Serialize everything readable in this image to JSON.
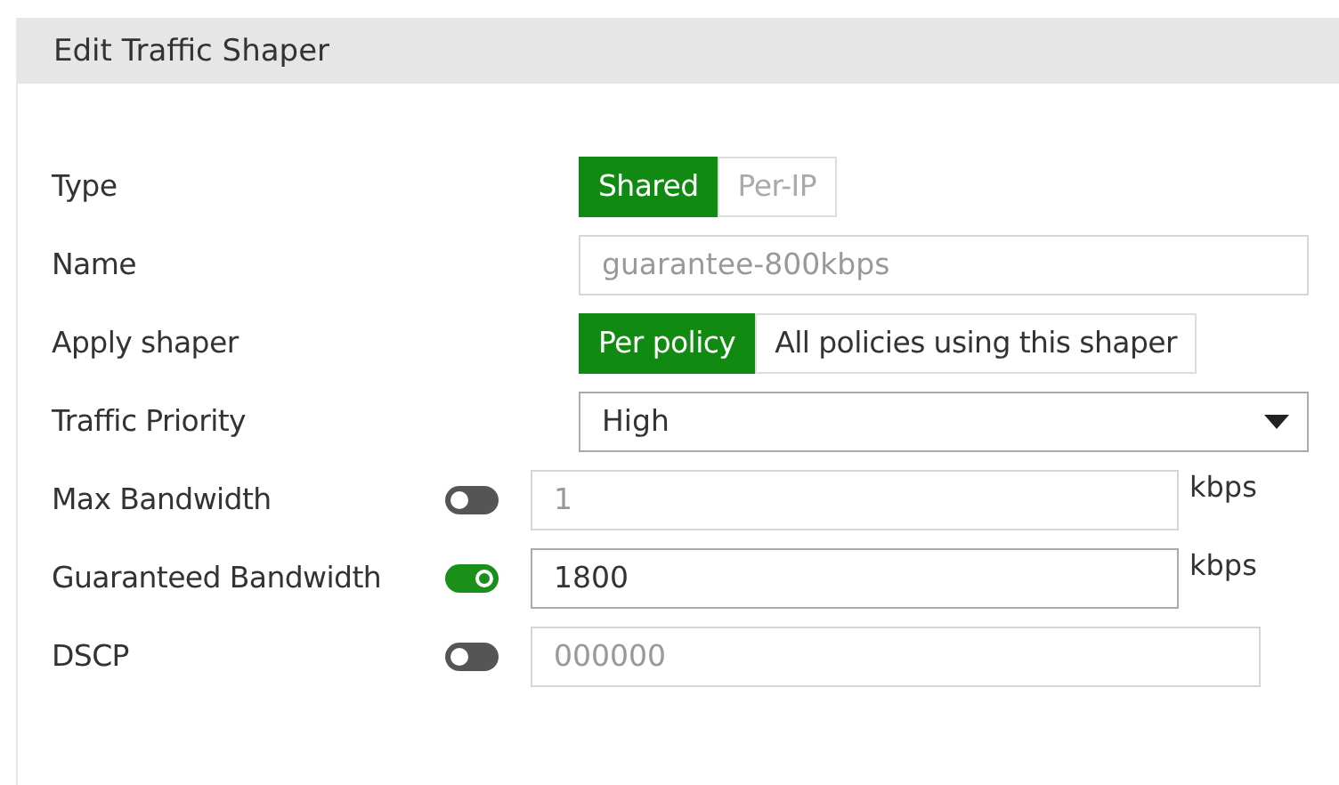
{
  "panel": {
    "title": "Edit Traffic Shaper"
  },
  "rows": [
    {
      "kind": "segmented",
      "label": "Type",
      "options": [
        {
          "label": "Shared",
          "selected": true
        },
        {
          "label": "Per-IP",
          "selected": false,
          "disabled": true
        }
      ]
    },
    {
      "kind": "text",
      "label": "Name",
      "value": "guarantee-800kbps",
      "disabled": true
    },
    {
      "kind": "segmented",
      "label": "Apply shaper",
      "options": [
        {
          "label": "Per policy",
          "selected": true
        },
        {
          "label": "All policies using this shaper",
          "selected": false,
          "disabled": false
        }
      ]
    },
    {
      "kind": "select",
      "label": "Traffic Priority",
      "value": "High"
    },
    {
      "kind": "toggle",
      "label": "Max Bandwidth",
      "on": false,
      "value": "1",
      "unit": "kbps"
    },
    {
      "kind": "toggle",
      "label": "Guaranteed Bandwidth",
      "on": true,
      "value": "1800",
      "unit": "kbps"
    },
    {
      "kind": "toggle",
      "label": "DSCP",
      "on": false,
      "value": "000000"
    }
  ]
}
